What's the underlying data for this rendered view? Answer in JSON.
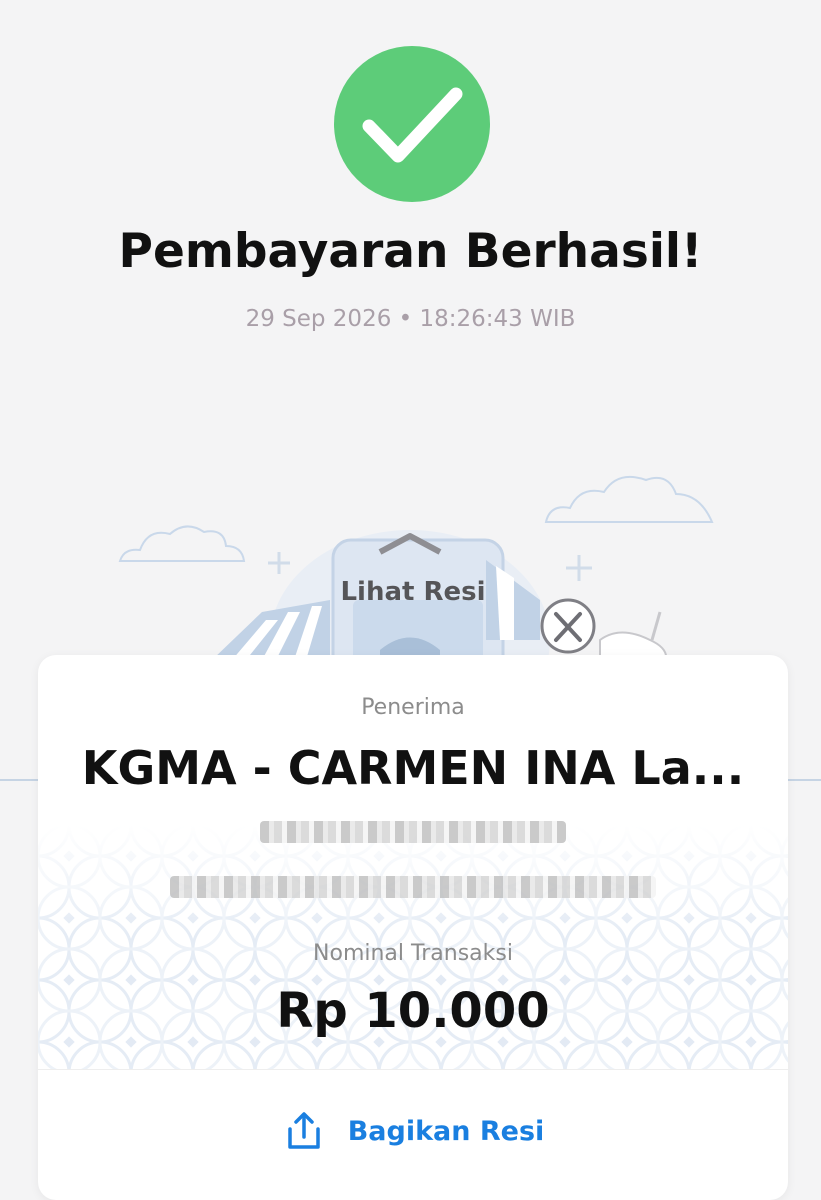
{
  "header": {
    "title": "Pembayaran Berhasil!",
    "datetime": "29 Sep 2026 • 18:26:43 WIB",
    "status_icon": "check-circle-icon",
    "accent_color": "#5dcc79"
  },
  "illustration": {
    "link_label": "Lihat Resi"
  },
  "receipt": {
    "recipient_label": "Penerima",
    "recipient_name": "KGMA - CARMEN INA La...",
    "amount_label": "Nominal Transaksi",
    "amount": "Rp 10.000",
    "share_label": "Bagikan Resi",
    "share_icon": "share-upload-icon",
    "share_color": "#1a7fe0"
  }
}
